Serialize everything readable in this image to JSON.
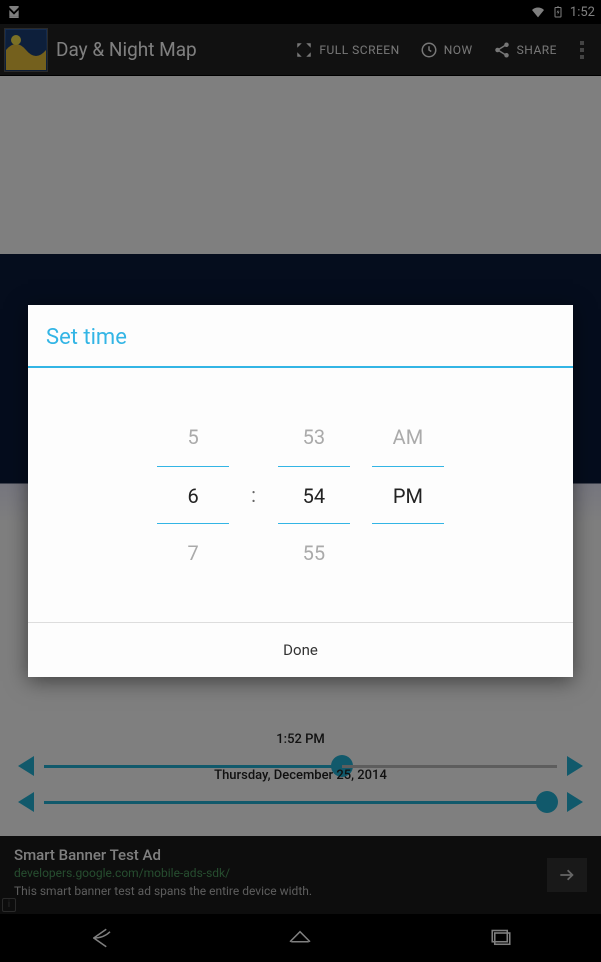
{
  "status": {
    "time": "1:52"
  },
  "actionbar": {
    "title": "Day & Night Map",
    "fullscreen": "FULL SCREEN",
    "now": "NOW",
    "share": "SHARE"
  },
  "sliders": {
    "time_label": "1:52 PM",
    "date_label": "Thursday, December 25, 2014"
  },
  "ad": {
    "title": "Smart Banner Test Ad",
    "url": "developers.google.com/mobile-ads-sdk/",
    "body": "This smart banner test ad spans the entire device width."
  },
  "dialog": {
    "title": "Set time",
    "done": "Done",
    "hour": {
      "prev": "5",
      "sel": "6",
      "next": "7"
    },
    "minute": {
      "prev": "53",
      "sel": "54",
      "next": "55"
    },
    "ampm": {
      "prev": "AM",
      "sel": "PM",
      "next": ""
    }
  }
}
